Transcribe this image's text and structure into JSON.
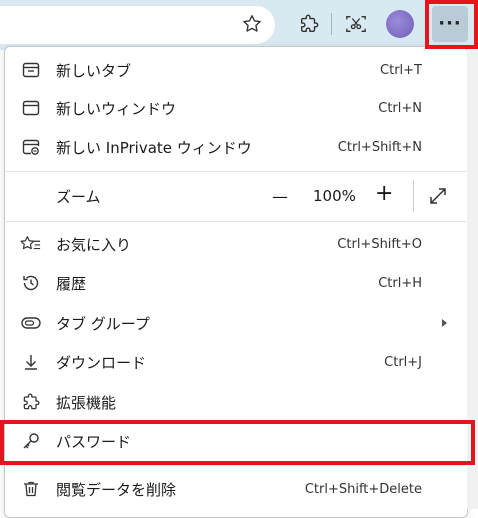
{
  "toolbar": {
    "favorite_icon": "star-outline-icon",
    "extensions_icon": "puzzle-icon",
    "screenshot_icon": "web-capture-icon",
    "profile_icon": "avatar",
    "more_label": "···"
  },
  "menu": {
    "new_tab": {
      "label": "新しいタブ",
      "shortcut": "Ctrl+T"
    },
    "new_window": {
      "label": "新しいウィンドウ",
      "shortcut": "Ctrl+N"
    },
    "new_inprivate": {
      "label": "新しい InPrivate ウィンドウ",
      "shortcut": "Ctrl+Shift+N"
    },
    "zoom": {
      "label": "ズーム",
      "minus": "—",
      "value": "100%",
      "plus": "+",
      "fullscreen_icon": "expand-icon"
    },
    "favorites": {
      "label": "お気に入り",
      "shortcut": "Ctrl+Shift+O"
    },
    "history": {
      "label": "履歴",
      "shortcut": "Ctrl+H"
    },
    "tab_groups": {
      "label": "タブ グループ"
    },
    "downloads": {
      "label": "ダウンロード",
      "shortcut": "Ctrl+J"
    },
    "extensions": {
      "label": "拡張機能"
    },
    "passwords": {
      "label": "パスワード"
    },
    "clear_data": {
      "label": "閲覧データを削除",
      "shortcut": "Ctrl+Shift+Delete"
    }
  },
  "colors": {
    "highlight": "#e5141d",
    "toolbar_bg": "#d8e9f2"
  }
}
